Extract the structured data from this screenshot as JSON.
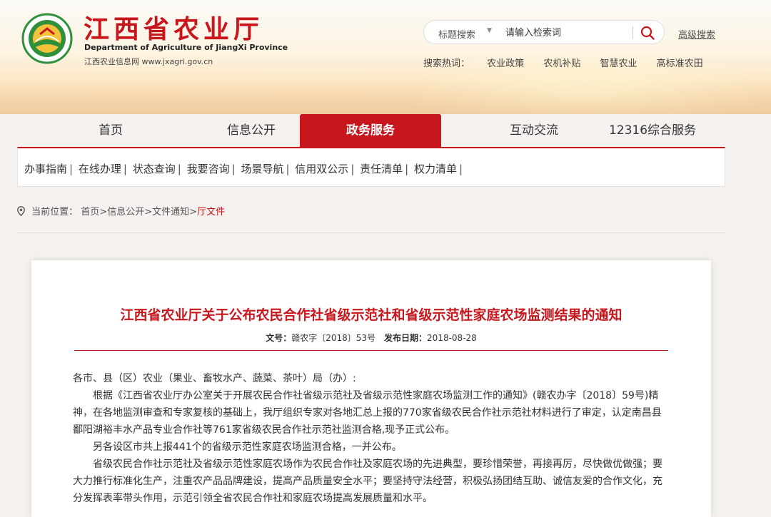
{
  "header": {
    "logo_name": "emblem-logo",
    "title": "江西省农业厅",
    "subtitle_en": "Department of Agriculture of JiangXi Province",
    "site": "江西农业信息网 www.jxagri.gov.cn",
    "search": {
      "type_label": "标题搜索",
      "placeholder": "请输入检索词",
      "button_icon": "search-icon"
    },
    "advanced_search": "高级搜索",
    "hot": {
      "label": "搜索热词：",
      "items": [
        "农业政策",
        "农机补贴",
        "智慧农业",
        "高标准农田"
      ]
    }
  },
  "nav": {
    "items": [
      "首页",
      "信息公开",
      "政务服务",
      "互动交流",
      "12316综合服务"
    ],
    "active": "政务服务"
  },
  "subnav": {
    "items": [
      "办事指南",
      "在线办理",
      "状态查询",
      "我要咨询",
      "场景导航",
      "信用双公示",
      "责任清单",
      "权力清单"
    ]
  },
  "breadcrumb": {
    "label": "当前位置：",
    "items": [
      "首页",
      "信息公开",
      "文件通知",
      "厅文件"
    ]
  },
  "article": {
    "title": "江西省农业厅关于公布农民合作社省级示范社和省级示范性家庭农场监测结果的通知",
    "doc_no_label": "文号：",
    "doc_no": "赣农字〔2018〕53号",
    "date_label": "发布日期：",
    "date": "2018-08-28",
    "salutation": "各市、县（区）农业（果业、畜牧水产、蔬菜、茶叶）局（办）:",
    "paragraphs": [
      "根据《江西省农业厅办公室关于开展农民合作社省级示范社及省级示范性家庭农场监测工作的通知》(赣农办字〔2018〕59号)精神，在各地监测审查和专家复核的基础上，我厅组织专家对各地汇总上报的770家省级农民合作社示范社材料进行了审定，认定南昌县鄱阳湖裕丰水产品专业合作社等761家省级农民合作社示范社监测合格,现予正式公布。",
      "另各设区市共上报441个的省级示范性家庭农场监测合格，一并公布。",
      "省级农民合作社示范社及省级示范性家庭农场作为农民合作社及家庭农场的先进典型，要珍惜荣誉，再接再厉，尽快做优做强；要大力推行标准化生产，注重农产品品牌建设，提高产品质量安全水平；要坚持守法经营，积极弘扬团结互助、诚信友爱的合作文化，充分发挥表率带头作用，示范引领全省农民合作社和家庭农场提高发展质量和水平。"
    ]
  },
  "colors": {
    "brand_red": "#c8161d",
    "logo_green": "#2f8f3a"
  }
}
